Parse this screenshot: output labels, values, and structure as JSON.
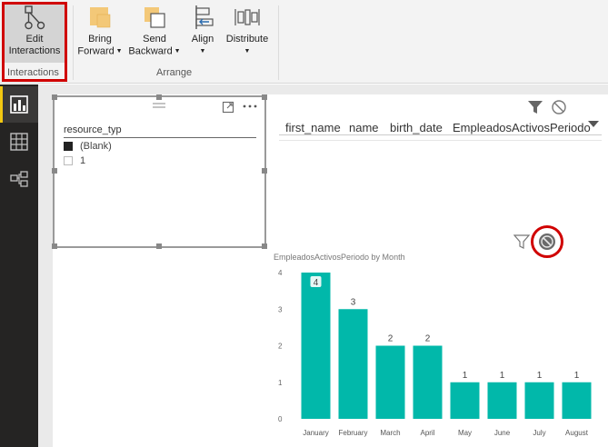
{
  "ribbon": {
    "edit_interactions": {
      "line1": "Edit",
      "line2": "Interactions"
    },
    "interactions_group_label": "Interactions",
    "bring_forward": {
      "line1": "Bring",
      "line2": "Forward"
    },
    "send_backward": {
      "line1": "Send",
      "line2": "Backward"
    },
    "align": {
      "label": "Align"
    },
    "distribute": {
      "label": "Distribute"
    },
    "arrange_group_label": "Arrange"
  },
  "slicer": {
    "field": "resource_typ",
    "items": [
      {
        "label": "(Blank)",
        "checked": true
      },
      {
        "label": "1",
        "checked": false
      }
    ]
  },
  "table": {
    "columns": [
      "first_name",
      "name",
      "birth_date",
      "EmpleadosActivosPeriodo"
    ]
  },
  "colors": {
    "bar": "#01b8aa",
    "highlight": "#d00000",
    "nav_bg": "#252423",
    "nav_accent": "#f2c811"
  },
  "chart_data": {
    "type": "bar",
    "title": "EmpleadosActivosPeriodo by Month",
    "categories": [
      "January",
      "February",
      "March",
      "April",
      "May",
      "June",
      "July",
      "August"
    ],
    "values": [
      4,
      3,
      2,
      2,
      1,
      1,
      1,
      1
    ],
    "yticks": [
      "0",
      "1",
      "2",
      "3",
      "4"
    ],
    "ylim": [
      0,
      4
    ],
    "highlighted_label_index": 0
  }
}
